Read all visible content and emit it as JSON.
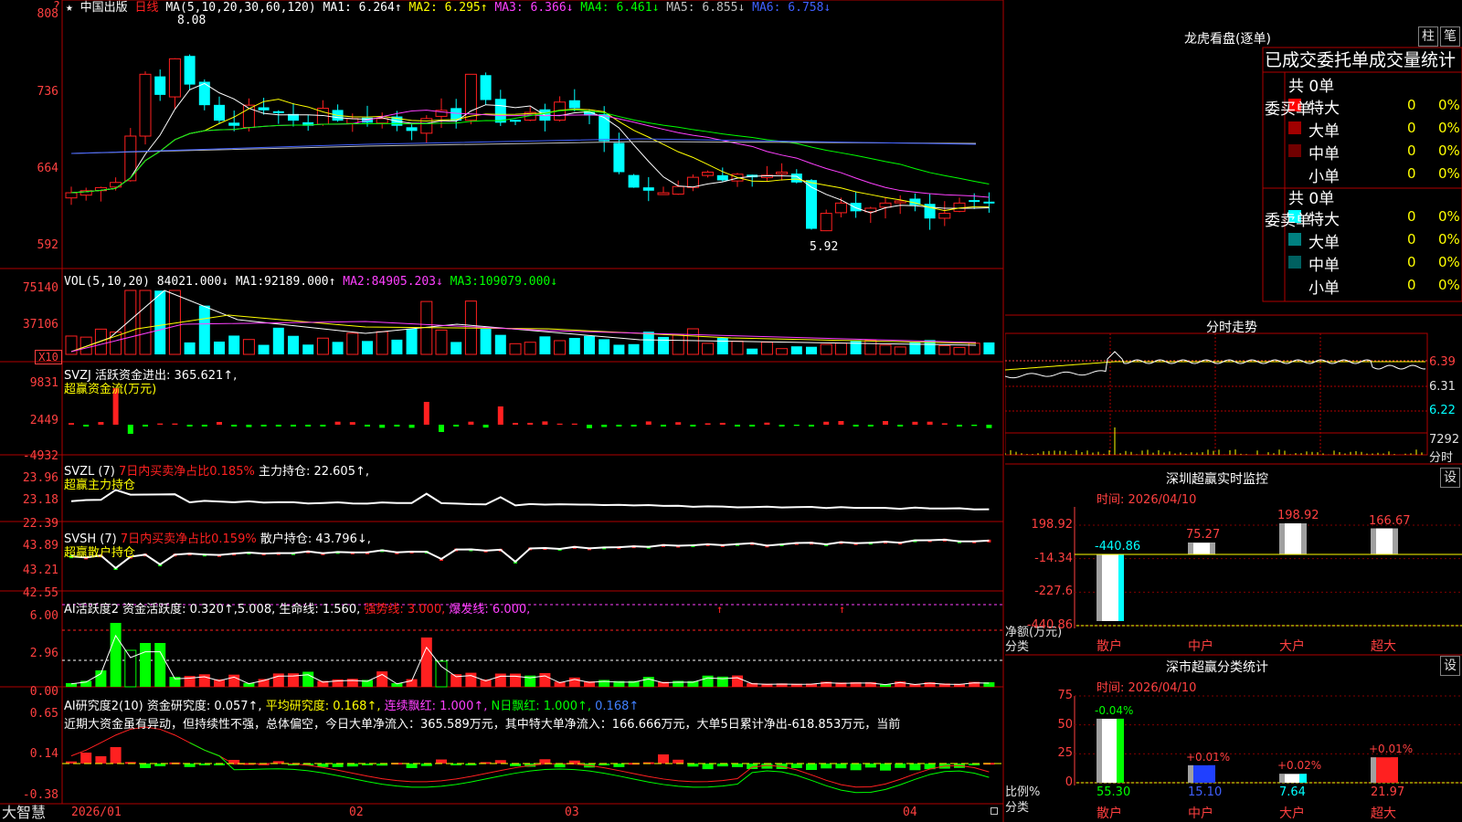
{
  "app": {
    "brand": "大智慧"
  },
  "main": {
    "stock": "中国出版",
    "star": "★",
    "period": "日线",
    "ma_params": "MA(5,10,20,30,60,120)",
    "ma_values": [
      {
        "label": "MA1:",
        "value": "6.264↑",
        "color": "#ffffff"
      },
      {
        "label": "MA2:",
        "value": "6.295↑",
        "color": "#ffff00"
      },
      {
        "label": "MA3:",
        "value": "6.366↓",
        "color": "#ff40ff"
      },
      {
        "label": "MA4:",
        "value": "6.461↓",
        "color": "#00ff00"
      },
      {
        "label": "MA5:",
        "value": "6.855↓",
        "color": "#c0c0c0"
      },
      {
        "label": "MA6:",
        "value": "6.758↓",
        "color": "#4060ff"
      }
    ],
    "yticks": [
      "808",
      "736",
      "664",
      "592"
    ],
    "high_label": "8.08",
    "low_label": "5.92",
    "corner": "?"
  },
  "vol": {
    "title": "VOL(5,10,20)",
    "value": "84021.000↓",
    "ma": [
      {
        "label": "MA1:",
        "value": "92189.000↑",
        "color": "#ffffff"
      },
      {
        "label": "MA2:",
        "value": "84905.203↓",
        "color": "#ff40ff"
      },
      {
        "label": "MA3:",
        "value": "109079.000↓",
        "color": "#00ff00"
      }
    ],
    "yticks": [
      "75140",
      "37106"
    ],
    "unit": "X10"
  },
  "svzj": {
    "line1": "SVZJ  活跃资金进出: 365.621↑,",
    "line2": "超赢资金流(万元)",
    "yticks": [
      "9831",
      "2449",
      "-4932"
    ]
  },
  "svzl": {
    "pre": "SVZL (7) ",
    "red": "7日内买卖净占比0.185%",
    "post": " 主力持仓: 22.605↑,",
    "line2": "超赢主力持仓",
    "yticks": [
      "23.96",
      "23.18",
      "22.39"
    ]
  },
  "svsh": {
    "pre": "SVSH (7) ",
    "red": "7日内买卖净占比0.159%",
    "post": " 散户持仓: 43.796↓,",
    "line2": "超赢散户持仓",
    "yticks": [
      "43.89",
      "43.21",
      "42.55"
    ]
  },
  "ai1": {
    "t1": "AI活跃度2 资金活跃度: 0.320↑,5.008,",
    "t2": "生命线: 1.560,",
    "t3": "强势线: 3.000,",
    "t4": "爆发线: 6.000,",
    "yticks": [
      "6.00",
      "2.96",
      "0.00"
    ]
  },
  "ai2": {
    "t1": "AI研究度2(10) 资金研究度: 0.057↑,",
    "t2": "平均研究度: 0.168↑,",
    "t3": "连续飘红: 1.000↑,",
    "t4": "N日飘红: 1.000↑,",
    "t5": "0.168↑",
    "desc": "近期大资金虽有异动，但持续性不强，总体偏空，今日大单净流入：365.589万元，其中特大单净流入：166.666万元，大单5日累计净出-618.853万元，当前",
    "yticks": [
      "0.65",
      "0.14",
      "-0.38"
    ]
  },
  "xaxis": [
    "2026/01",
    "02",
    "03",
    "04"
  ],
  "right": {
    "lhkp_title": "龙虎看盘(逐单)",
    "btn_zhu": "柱",
    "btn_bi": "笔",
    "tabs": "已成交委托单成交量统计",
    "buy_label": "委买单",
    "sell_label": "委卖单",
    "buy": {
      "total": "共 0单",
      "rows": [
        {
          "name": "特大",
          "count": "0",
          "pct": "0%",
          "color": "#ff0000"
        },
        {
          "name": "大单",
          "count": "0",
          "pct": "0%",
          "color": "#a00000"
        },
        {
          "name": "中单",
          "count": "0",
          "pct": "0%",
          "color": "#700000"
        },
        {
          "name": "小单",
          "count": "0",
          "pct": "0%",
          "color": ""
        }
      ]
    },
    "sell": {
      "total": "共 0单",
      "rows": [
        {
          "name": "特大",
          "count": "0",
          "pct": "0%",
          "color": "#00ffff"
        },
        {
          "name": "大单",
          "count": "0",
          "pct": "0%",
          "color": "#008080"
        },
        {
          "name": "中单",
          "count": "0",
          "pct": "0%",
          "color": "#006060"
        },
        {
          "name": "小单",
          "count": "0",
          "pct": "0%",
          "color": ""
        }
      ]
    },
    "fs_title": "分时走势",
    "fs_yticks": [
      "6.39",
      "6.31",
      "6.22"
    ],
    "fs_vol": "7292",
    "fs_tag": "分时",
    "sz_title": "深圳超赢实时监控",
    "set": "设",
    "sz_time": "时间: 2026/04/10",
    "sz_yticks": [
      "198.92",
      "-14.34",
      "-227.6",
      "-440.86"
    ],
    "sz_axis_label": "净额(万元)",
    "sz_cat_label": "分类",
    "sz_bars": [
      {
        "cat": "散户",
        "value": -440.86,
        "label": "-440.86"
      },
      {
        "cat": "中户",
        "value": 75.27,
        "label": "75.27"
      },
      {
        "cat": "大户",
        "value": 198.92,
        "label": "198.92"
      },
      {
        "cat": "超大",
        "value": 166.67,
        "label": "166.67"
      }
    ],
    "cls_title": "深市超赢分类统计",
    "cls_time": "时间: 2026/04/10",
    "cls_yticks": [
      "75",
      "50",
      "25",
      "0"
    ],
    "cls_axis_label": "比例%",
    "cls_cat_label": "分类",
    "cls_bars": [
      {
        "cat": "散户",
        "value": 55.3,
        "label": "55.30",
        "delta": "-0.04%",
        "color": "#00ff00",
        "fill": "#ffffff"
      },
      {
        "cat": "中户",
        "value": 15.1,
        "label": "15.10",
        "delta": "+0.01%",
        "color": "#2040ff",
        "fill": "#2040ff"
      },
      {
        "cat": "大户",
        "value": 7.64,
        "label": "7.64",
        "delta": "+0.02%",
        "color": "#00ffff",
        "fill": "#ffffff"
      },
      {
        "cat": "超大",
        "value": 21.97,
        "label": "21.97",
        "delta": "+0.01%",
        "color": "#ff2020",
        "fill": "#ff2020"
      }
    ]
  },
  "chart_data": [
    {
      "type": "bar",
      "categories": [
        "散户",
        "中户",
        "大户",
        "超大"
      ],
      "values": [
        -440.86,
        75.27,
        198.92,
        166.67
      ],
      "title": "深圳超赢实时监控",
      "xlabel": "分类",
      "ylabel": "净额(万元)",
      "ylim": [
        -440.86,
        198.92
      ]
    },
    {
      "type": "bar",
      "categories": [
        "散户",
        "中户",
        "大户",
        "超大"
      ],
      "values": [
        55.3,
        15.1,
        7.64,
        21.97
      ],
      "title": "深市超赢分类统计",
      "xlabel": "分类",
      "ylabel": "比例%",
      "ylim": [
        0,
        75
      ]
    }
  ]
}
